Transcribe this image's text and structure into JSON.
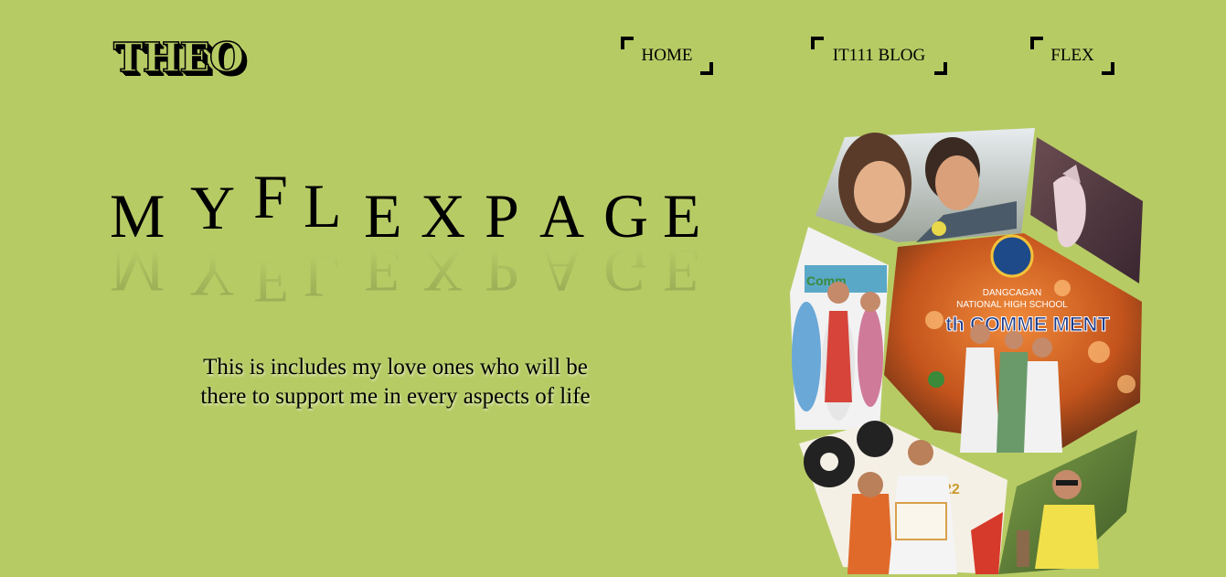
{
  "header": {
    "logo": "THEO",
    "nav": [
      {
        "label": "HOME"
      },
      {
        "label": "IT111 BLOG"
      },
      {
        "label": "FLEX"
      }
    ]
  },
  "hero": {
    "title_letters": [
      "M",
      "Y",
      "F",
      "L",
      "E",
      "X",
      "P",
      "A",
      "G",
      "E"
    ],
    "tagline_line1": "This is includes my love ones who will be",
    "tagline_line2": "there to support me in every aspects of life"
  },
  "collage": {
    "school_name_line1": "DANGCAGAN",
    "school_name_line2": "NATIONAL HIGH SCHOOL",
    "banner_text": "th COMME    MENT",
    "certificate_year": "2022",
    "photos": [
      "selfie-couple",
      "hand-closeup",
      "graduation-family",
      "commencement-stage",
      "certificate-award",
      "friend-outdoors"
    ]
  }
}
